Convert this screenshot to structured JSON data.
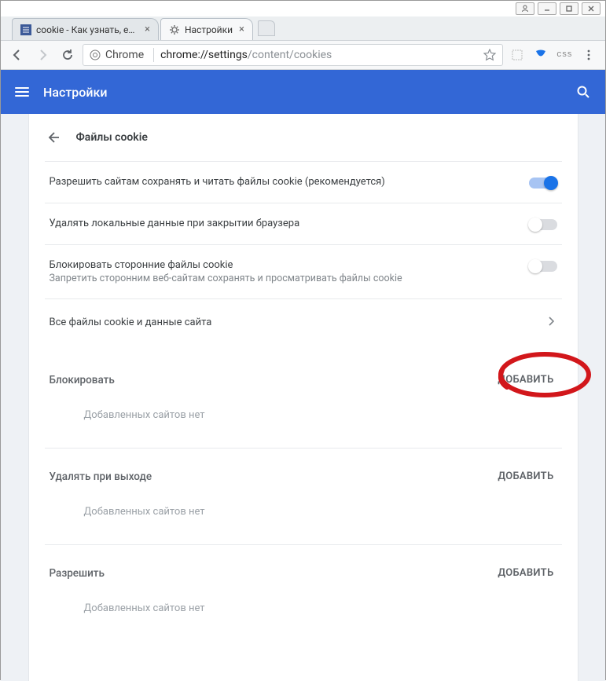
{
  "window": {
    "controls": [
      "user",
      "min",
      "max",
      "close"
    ]
  },
  "tabs": [
    {
      "title": "cookie - Как узнать, есть",
      "active": false,
      "favicon": "stack"
    },
    {
      "title": "Настройки",
      "active": true,
      "favicon": "gear"
    }
  ],
  "omnibox": {
    "scheme_label": "Chrome",
    "url_highlight": "chrome://settings",
    "url_rest": "/content/cookies"
  },
  "toolbar_icons": {
    "ext1": "⯐",
    "ext2": "S",
    "ext3": "css"
  },
  "header": {
    "title": "Настройки"
  },
  "breadcrumb": {
    "title": "Файлы cookie"
  },
  "settings": [
    {
      "label": "Разрешить сайтам сохранять и читать файлы cookie (рекомендуется)",
      "sub": "",
      "toggle": "on"
    },
    {
      "label": "Удалять локальные данные при закрытии браузера",
      "sub": "",
      "toggle": "off"
    },
    {
      "label": "Блокировать сторонние файлы cookie",
      "sub": "Запретить сторонним веб-сайтам сохранять и просматривать файлы cookie",
      "toggle": "off"
    },
    {
      "label": "Все файлы cookie и данные сайта",
      "sub": "",
      "chevron": true
    }
  ],
  "sections": [
    {
      "title": "Блокировать",
      "add": "ДОБАВИТЬ",
      "empty": "Добавленных сайтов нет"
    },
    {
      "title": "Удалять при выходе",
      "add": "ДОБАВИТЬ",
      "empty": "Добавленных сайтов нет"
    },
    {
      "title": "Разрешить",
      "add": "ДОБАВИТЬ",
      "empty": "Добавленных сайтов нет"
    }
  ]
}
